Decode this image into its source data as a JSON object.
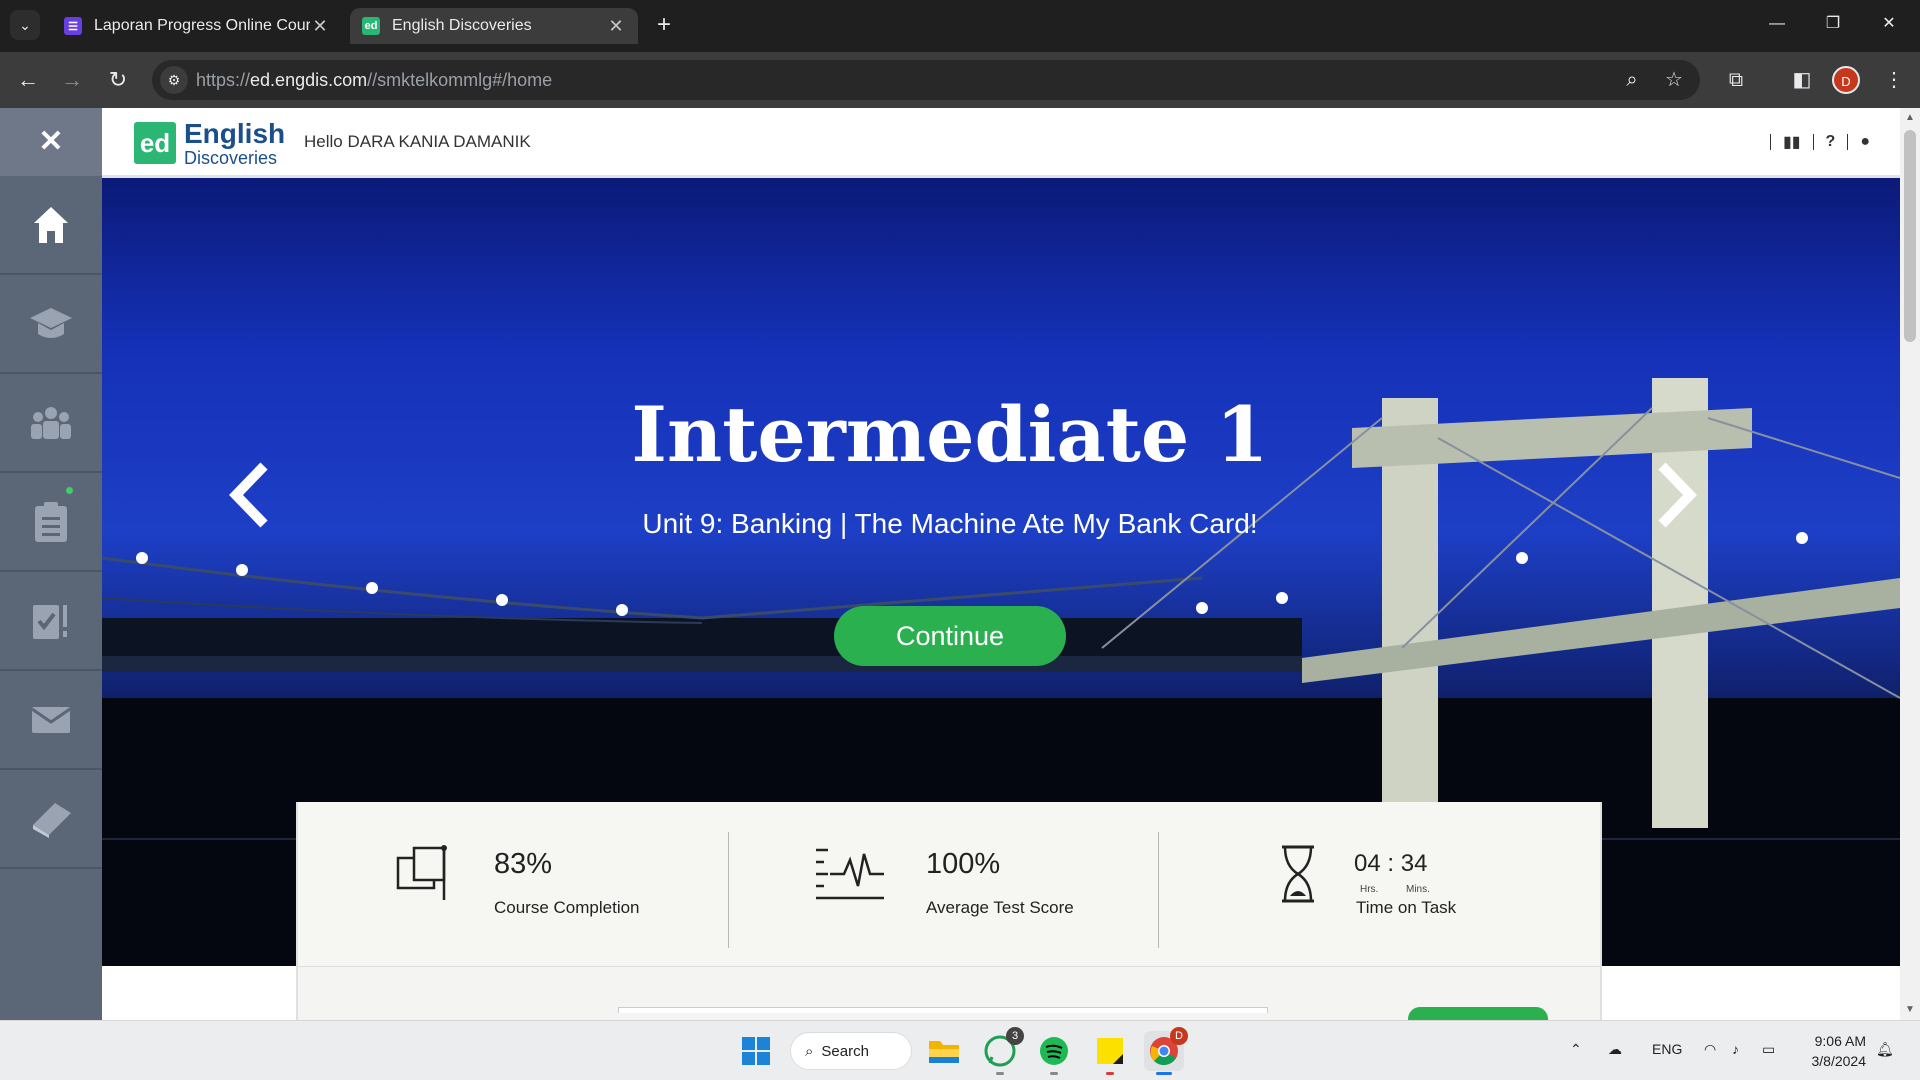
{
  "browser": {
    "tabs": [
      {
        "title": "Laporan Progress Online Course",
        "active": false
      },
      {
        "title": "English Discoveries",
        "active": true
      }
    ],
    "url_prefix": "https://",
    "url_host": "ed.engdis.com",
    "url_path": "//smktelkommlg#/home",
    "profile_initial": "D",
    "window_controls": [
      "minimize",
      "restore",
      "close"
    ]
  },
  "header": {
    "logo_badge": "ed",
    "logo_line1": "English",
    "logo_line2": "Discoveries",
    "greeting": "Hello DARA KANIA DAMANIK"
  },
  "sidebar": {
    "close_label": "✕",
    "items": [
      "home-icon",
      "course-icon",
      "community-icon",
      "assignments-icon",
      "tests-icon",
      "messages-icon",
      "dictionary-icon"
    ]
  },
  "hero": {
    "title": "Intermediate 1",
    "subtitle": "Unit 9: Banking  |  The Machine Ate My Bank Card!",
    "continue_label": "Continue",
    "prev_icon": "chevron-left-icon",
    "next_icon": "chevron-right-icon"
  },
  "stats": {
    "course_completion_value": "83%",
    "course_completion_label": "Course Completion",
    "avg_score_value": "100%",
    "avg_score_label": "Average Test Score",
    "time_hours": "04",
    "time_separator": ":",
    "time_minutes": "34",
    "time_hours_unit": "Hrs.",
    "time_minutes_unit": "Mins.",
    "time_label": "Time on Task"
  },
  "taskbar": {
    "search_label": "Search",
    "whatsapp_badge": "3",
    "chrome_badge": "D",
    "lang": "ENG",
    "time": "9:06 AM",
    "date": "3/8/2024"
  },
  "colors": {
    "sidebar": "#5b6677",
    "accent_green": "#2bb050",
    "brand_blue": "#1b4f8a"
  }
}
